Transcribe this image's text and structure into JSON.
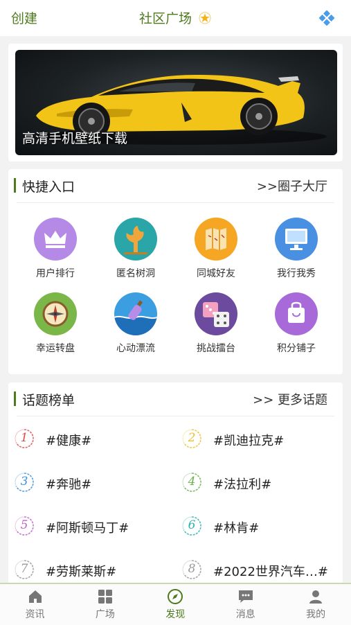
{
  "header": {
    "left_label": "创建",
    "title": "社区广场",
    "title_icon": "star-icon",
    "right_icon": "diamond-grid-icon"
  },
  "banner": {
    "caption": "高清手机壁纸下载",
    "image": "yellow-sports-car"
  },
  "quick_entry": {
    "title": "快捷入口",
    "more": ">>圈子大厅",
    "items": [
      {
        "label": "用户排行",
        "icon": "crown-icon",
        "color": "#b48ae6"
      },
      {
        "label": "匿名树洞",
        "icon": "tree-icon",
        "color": "#2aa6a8"
      },
      {
        "label": "同城好友",
        "icon": "map-icon",
        "color": "#f5a623"
      },
      {
        "label": "我行我秀",
        "icon": "monitor-icon",
        "color": "#4a90e2"
      },
      {
        "label": "幸运转盘",
        "icon": "compass-icon",
        "color": "#7ab648"
      },
      {
        "label": "心动漂流",
        "icon": "bottle-icon",
        "color": "#3b9ee0"
      },
      {
        "label": "挑战擂台",
        "icon": "dice-icon",
        "color": "#6c4a9e"
      },
      {
        "label": "积分铺子",
        "icon": "shopping-bag-icon",
        "color": "#a86ad8"
      }
    ]
  },
  "topics": {
    "title": "话题榜单",
    "more": ">> 更多话题",
    "items": [
      {
        "rank": "1",
        "label": "#健康#",
        "color": "#e24a4a"
      },
      {
        "rank": "2",
        "label": "#凯迪拉克#",
        "color": "#f0c02c"
      },
      {
        "rank": "3",
        "label": "#奔驰#",
        "color": "#3b8fd9"
      },
      {
        "rank": "4",
        "label": "#法拉利#",
        "color": "#6ab04c"
      },
      {
        "rank": "5",
        "label": "#阿斯顿马丁#",
        "color": "#c060c8"
      },
      {
        "rank": "6",
        "label": "#林肯#",
        "color": "#2ab3b0"
      },
      {
        "rank": "7",
        "label": "#劳斯莱斯#",
        "color": "#999999"
      },
      {
        "rank": "8",
        "label": "#2022世界汽车…#",
        "color": "#999999"
      }
    ]
  },
  "tabbar": {
    "items": [
      {
        "label": "资讯",
        "icon": "home-icon",
        "active": false
      },
      {
        "label": "广场",
        "icon": "grid-icon",
        "active": false
      },
      {
        "label": "发现",
        "icon": "compass-icon",
        "active": true
      },
      {
        "label": "消息",
        "icon": "chat-icon",
        "active": false
      },
      {
        "label": "我的",
        "icon": "user-icon",
        "active": false
      }
    ],
    "active_color": "#4d7a1c",
    "inactive_color": "#777777"
  }
}
